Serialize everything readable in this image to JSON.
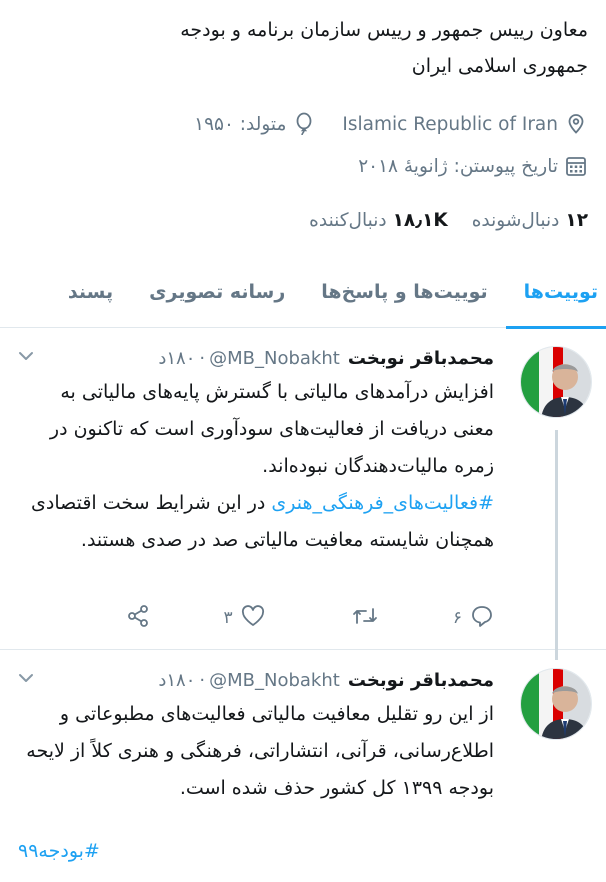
{
  "profile": {
    "bio_line1": "معاون رییس جمهور و رییس سازمان برنامه و بودجه",
    "bio_line2": "جمهوری اسلامی ایران",
    "location": "Islamic Republic of Iran",
    "born": "متولد: ۱۹۵۰",
    "joined": "تاریخ پیوستن: ژانویهٔ ۲۰۱۸",
    "following_count": "۱۲",
    "following_label": "دنبال‌شونده",
    "followers_count": "۱۸٫۱K",
    "followers_label": "دنبال‌کننده"
  },
  "tabs": [
    {
      "label": "توییت‌ها",
      "active": true
    },
    {
      "label": "توییت‌ها و پاسخ‌ها",
      "active": false
    },
    {
      "label": "رسانه تصویری",
      "active": false
    },
    {
      "label": "پسند",
      "active": false
    }
  ],
  "tweets": [
    {
      "name": "محمدباقر نوبخت",
      "handle": "@MB_Nobakht",
      "time": "۱۸۰د",
      "body_part1": "افزایش درآمدهای مالیاتی با گسترش پایه‌های مالیاتی به معنی دریافت از فعالیت‌های سودآوری است که تاکنون در زمره مالیات‌دهندگان نبوده‌اند.",
      "hashtag": "#فعالیت‌های_فرهنگی_هنری",
      "body_part2": " در این شرایط سخت اقتصادی همچنان شایسته معافیت مالیاتی صد در صدی هستند.",
      "replies": "۶",
      "retweets": "",
      "likes": "۳"
    },
    {
      "name": "محمدباقر نوبخت",
      "handle": "@MB_Nobakht",
      "time": "۱۸۰د",
      "body": "از این رو تقلیل معافیت مالیاتی فعالیت‌های مطبوعاتی و اطلاع‌رسانی، قرآنی، انتشاراتی، فرهنگی و هنری کلاً از لایحه بودجه ۱۳۹۹ کل کشور حذف شده است.",
      "hashtag": "#بودجه۹۹"
    }
  ],
  "colors": {
    "accent": "#1da1f2",
    "muted": "#657786",
    "text": "#14171a",
    "flag_green": "#239f40",
    "flag_red": "#da0000"
  },
  "icons": {
    "location": "map-pin-icon",
    "born": "balloon-icon",
    "joined": "calendar-icon",
    "reply": "reply-icon",
    "retweet": "retweet-icon",
    "like": "heart-icon",
    "share": "share-icon",
    "more": "chevron-down-icon"
  }
}
